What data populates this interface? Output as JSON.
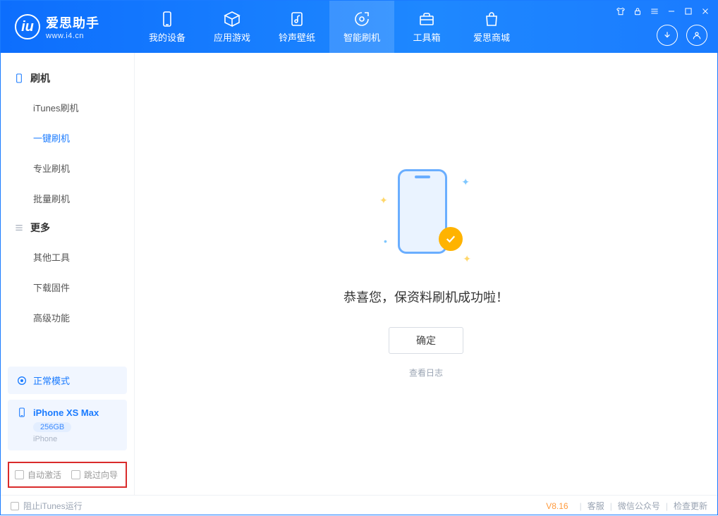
{
  "brand": {
    "name": "爱思助手",
    "url": "www.i4.cn"
  },
  "nav": {
    "device": "我的设备",
    "apps": "应用游戏",
    "ring": "铃声壁纸",
    "flash": "智能刷机",
    "toolbox": "工具箱",
    "store": "爱思商城"
  },
  "sidebar": {
    "group_flash": "刷机",
    "items_flash": {
      "itunes": "iTunes刷机",
      "oneclick": "一键刷机",
      "pro": "专业刷机",
      "batch": "批量刷机"
    },
    "group_more": "更多",
    "items_more": {
      "other": "其他工具",
      "firmware": "下载固件",
      "advanced": "高级功能"
    }
  },
  "device_panel": {
    "mode": "正常模式",
    "name": "iPhone XS Max",
    "capacity": "256GB",
    "type": "iPhone"
  },
  "options": {
    "auto_activate": "自动激活",
    "skip_wizard": "跳过向导"
  },
  "main": {
    "success": "恭喜您，保资料刷机成功啦！",
    "ok": "确定",
    "viewlog": "查看日志"
  },
  "footer": {
    "block_itunes": "阻止iTunes运行",
    "version": "V8.16",
    "support": "客服",
    "wechat": "微信公众号",
    "update": "检查更新"
  }
}
